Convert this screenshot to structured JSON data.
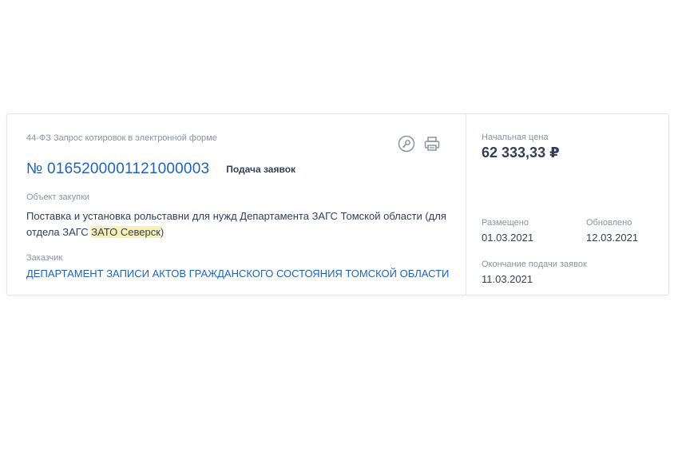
{
  "procurement": {
    "type_label": "44-ФЗ Запрос котировок в электронной форме",
    "number": "№ 0165200001121000003",
    "status": "Подача заявок",
    "object_label": "Объект закупки",
    "object_text_1": "Поставка и установка рольставни для нужд Департамента ЗАГС Томской области (для отдела ЗАГС ",
    "object_highlight": "ЗАТО Северск",
    "object_text_2": ")",
    "customer_label": "Заказчик",
    "customer": "ДЕПАРТАМЕНТ ЗАПИСИ АКТОВ ГРАЖДАНСКОГО СОСТОЯНИЯ ТОМСКОЙ ОБЛАСТИ",
    "icons": [
      "key-icon",
      "print-icon"
    ]
  },
  "summary": {
    "price_label": "Начальная цена",
    "price": "62 333,33 ₽",
    "posted_label": "Размещено",
    "posted": "01.03.2021",
    "updated_label": "Обновлено",
    "updated": "12.03.2021",
    "deadline_label": "Окончание подачи заявок",
    "deadline": "11.03.2021"
  },
  "colors": {
    "link": "#1f63b6",
    "text": "#334059",
    "muted": "#8a93a0",
    "highlight": "#fbf0b3",
    "border": "#e3e7ed"
  }
}
